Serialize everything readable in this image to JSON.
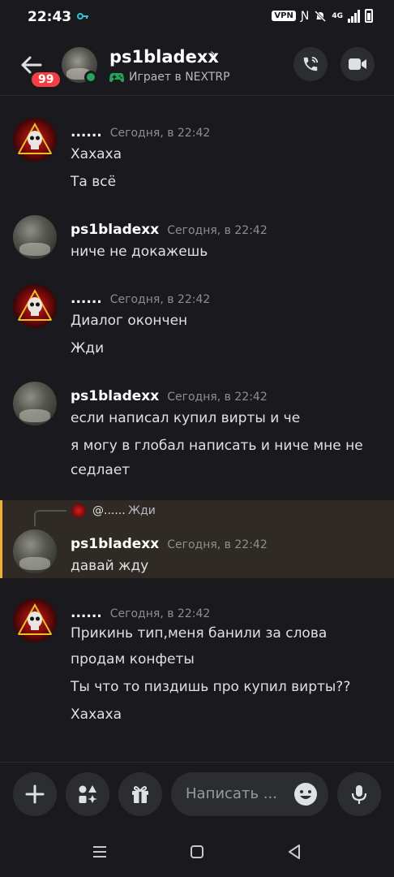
{
  "status_bar": {
    "time": "22:43",
    "vpn": "VPN",
    "network": "4G"
  },
  "header": {
    "unread_count": "99",
    "name": "ps1bladexx",
    "chevron": "›",
    "status": "Играет в NEXTRP",
    "online_color": "#23a55a",
    "icons": [
      "back-arrow-icon",
      "gamepad-icon",
      "phone-icon",
      "video-camera-icon"
    ]
  },
  "messages": [
    {
      "author": "......",
      "time": "Сегодня, в 22:42",
      "lines": [
        "Хахаха",
        "Та всё"
      ],
      "avatar": "skull"
    },
    {
      "author": "ps1bladexx",
      "time": "Сегодня, в 22:42",
      "lines": [
        "ниче не докажешь"
      ],
      "avatar": "photo"
    },
    {
      "author": "......",
      "time": "Сегодня, в 22:42",
      "lines": [
        "Диалог окончен",
        "Жди"
      ],
      "avatar": "skull"
    },
    {
      "author": "ps1bladexx",
      "time": "Сегодня, в 22:42",
      "lines": [
        "если написал купил вирты и че",
        "я могу в глобал написать и ниче мне не",
        "седлает"
      ],
      "avatar": "photo"
    },
    {
      "author": "ps1bladexx",
      "time": "Сегодня, в 22:42",
      "lines": [
        "давай жду"
      ],
      "avatar": "photo",
      "reply": {
        "author": "@......",
        "text": "Жди"
      }
    },
    {
      "author": "......",
      "time": "Сегодня, в 22:42",
      "lines": [
        "Прикинь тип,меня банили за слова",
        "продам конфеты",
        "Ты что то пиздишь про купил вирты??",
        "Хахаха"
      ],
      "avatar": "skull"
    }
  ],
  "composer": {
    "placeholder": "Написать ...",
    "icons": [
      "plus-icon",
      "apps-icon",
      "gift-icon",
      "emoji-icon",
      "microphone-icon"
    ]
  },
  "colors": {
    "background": "#1a1a1e",
    "highlight_border": "#f0b132",
    "badge": "#f23f43"
  }
}
